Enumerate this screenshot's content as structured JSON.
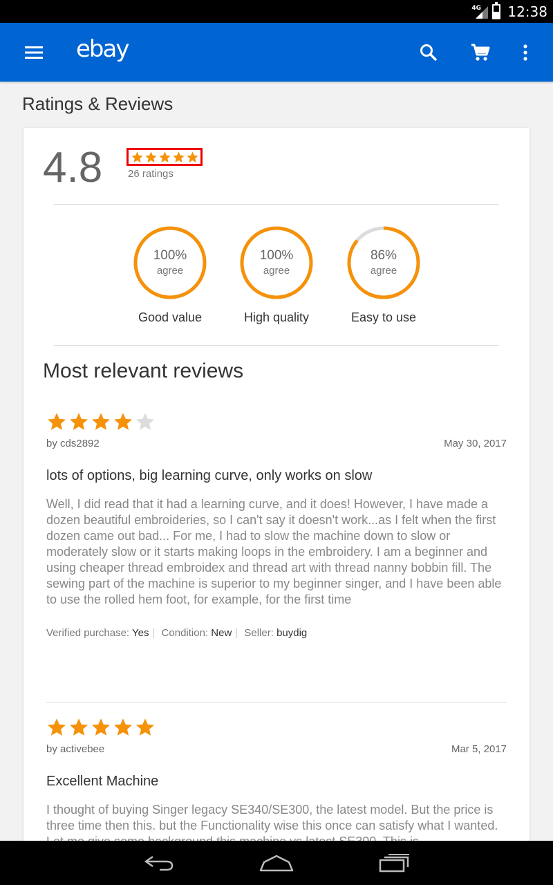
{
  "status_bar": {
    "network": "4G",
    "time": "12:38"
  },
  "app_bar": {
    "logo": "ebay"
  },
  "page": {
    "title": "Ratings & Reviews"
  },
  "summary": {
    "rating": "4.8",
    "rating_stars": 5,
    "ratings_count": "26 ratings"
  },
  "attributes": [
    {
      "percent": "100%",
      "agree": "agree",
      "label": "Good value",
      "fraction": 1.0
    },
    {
      "percent": "100%",
      "agree": "agree",
      "label": "High quality",
      "fraction": 1.0
    },
    {
      "percent": "86%",
      "agree": "agree",
      "label": "Easy to use",
      "fraction": 0.86
    }
  ],
  "reviews_section": {
    "title": "Most relevant reviews"
  },
  "reviews": [
    {
      "stars": 4,
      "author": "by cds2892",
      "date": "May 30, 2017",
      "title": "lots of options, big learning curve, only works on slow",
      "body": "Well, I did read that it had a learning curve, and it does! However, I have made a dozen beautiful embroideries, so I can't say it doesn't work...as I felt when the first dozen came out bad... For me, I had to slow the machine down to slow or moderately slow or it starts making loops in the embroidery. I am a beginner and using cheaper thread embroidex and thread art with thread nanny bobbin fill. The sewing part of the machine is superior to my beginner singer, and I have been able to use the rolled hem foot, for example, for the first time",
      "verified_label": "Verified purchase:",
      "verified_value": "Yes",
      "condition_label": "Condition:",
      "condition_value": "New",
      "seller_label": "Seller:",
      "seller_value": "buydig"
    },
    {
      "stars": 5,
      "author": "by activebee",
      "date": "Mar 5, 2017",
      "title": "Excellent Machine",
      "body": "I thought of buying Singer legacy SE340/SE300, the latest model. But the price is three time then this. but the Functionality wise this once can satisfy what I wanted. Let me give some background this machine vs latest SE300. This is"
    }
  ],
  "colors": {
    "brand_blue": "#0064d2",
    "star_orange": "#f5920a",
    "star_empty": "#dcdcdc",
    "highlight_red": "#e00000"
  }
}
